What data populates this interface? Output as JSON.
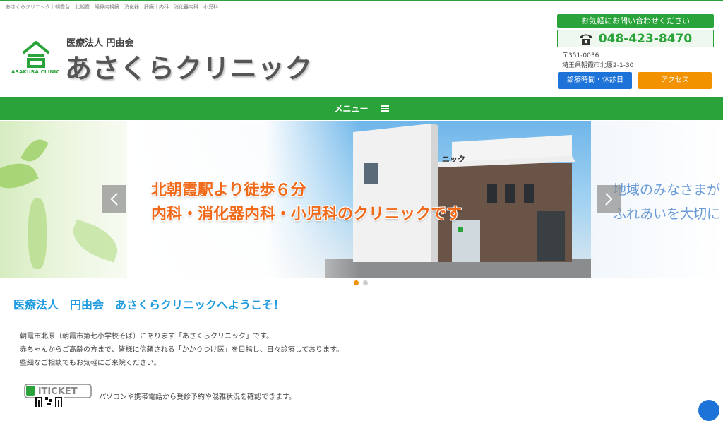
{
  "breadcrumb": "あさくらクリニック｜朝霞台　北朝霞｜経鼻内視鏡　消化器　肝臓｜内科　消化器内科　小児科",
  "logo": {
    "en_text": "ASAKURA CLINIC",
    "icon": "house-logo-icon"
  },
  "header": {
    "corp_name": "医療法人 円由会",
    "clinic_name": "あさくらクリニック"
  },
  "contact": {
    "label": "お気軽にお問い合わせください",
    "phone": "048-423-8470",
    "zip": "〒351-0036",
    "address": "埼玉県朝霞市北原2-1-30",
    "hours_button": "診療時間・休診日",
    "access_button": "アクセス"
  },
  "nav": {
    "menu_label": "メニュー"
  },
  "slider": {
    "line1": "北朝霞駅より徒歩６分",
    "line2": "内科・消化器内科・小児科のクリニックです",
    "next_line1": "地域のみなさまが",
    "next_line2": "ふれあいを大切に",
    "sign_text": "ニック",
    "active_index": 0,
    "count": 2
  },
  "welcome": {
    "title": "医療法人　円由会　あさくらクリニックへようこそ！",
    "lines": [
      "朝霞市北原（朝霞市第七小学校そば）にあります「あさくらクリニック」です。",
      "赤ちゃんからご高齢の方まで、皆様に信頼される「かかりつけ医」を目指し、日々診療しております。",
      "些細なご相談でもお気軽にご来院ください。"
    ]
  },
  "iticket": {
    "logo_text": "iTICKET",
    "description": "パソコンや携帯電話から受診予約や混雑状況を確認できます。"
  },
  "colors": {
    "green": "#2aa33a",
    "blue": "#1e73d8",
    "orange": "#f39200",
    "title_blue": "#1e9be0",
    "slide_orange": "#f06a1a"
  }
}
